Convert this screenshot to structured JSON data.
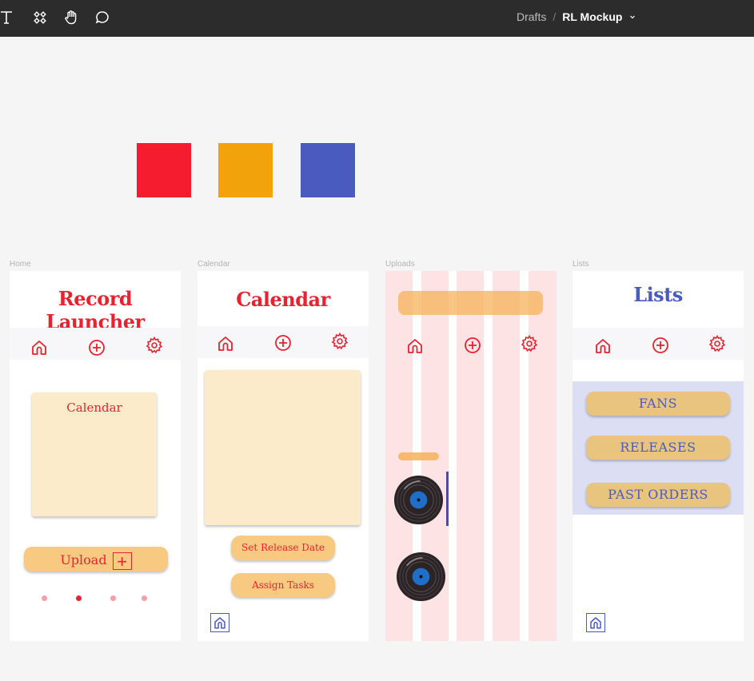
{
  "topbar": {
    "tools": [
      "text-tool-icon",
      "components-icon",
      "hand-tool-icon",
      "comment-icon"
    ],
    "breadcrumb_parent": "Drafts",
    "breadcrumb_separator": "/",
    "file_name": "RL Mockup",
    "file_menu_chevron": "chevron-down-icon"
  },
  "palette": {
    "colors": [
      "#f51c2f",
      "#f2a20a",
      "#4a5bc0"
    ]
  },
  "frames": {
    "home": {
      "label": "Home",
      "title": "Record Launcher",
      "card_title": "Calendar",
      "upload_label": "Upload",
      "upload_icon": "+",
      "page_dots": 4,
      "active_dot": 2
    },
    "calendar": {
      "label": "Calendar",
      "title": "Calendar",
      "button_set_release": "Set Release Date",
      "button_assign_tasks": "Assign Tasks"
    },
    "uploads": {
      "label": "Uploads"
    },
    "lists": {
      "label": "Lists",
      "title": "Lists",
      "items": [
        "FANS",
        "RELEASES",
        "PAST ORDERS"
      ]
    }
  },
  "nav_icons": [
    "home-icon",
    "add-circle-icon",
    "settings-gear-icon"
  ],
  "colors": {
    "red": "#e8222f",
    "blue": "#4a5bc0",
    "cream": "#fcebcb",
    "pill": "#f7c981",
    "topbar": "#2c2c2c"
  }
}
